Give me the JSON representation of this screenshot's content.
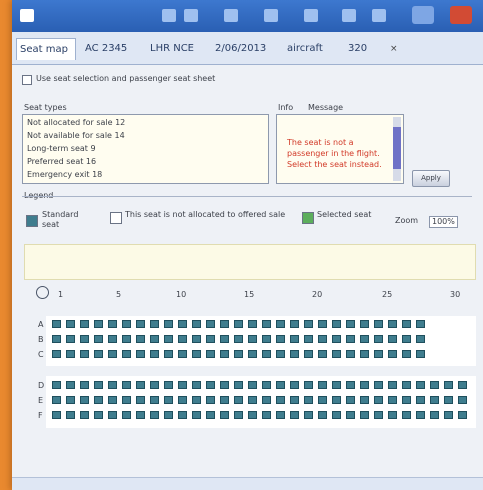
{
  "colors": {
    "accent": "#2a5fb3",
    "cell": "#3f7d8e",
    "message": "#d23a28"
  },
  "tabs": [
    {
      "label": "Seat map",
      "active": true
    },
    {
      "label": "AC 2345"
    },
    {
      "label": "LHR NCE"
    },
    {
      "label": "2/06/2013"
    },
    {
      "label": "aircraft"
    },
    {
      "label": "320"
    }
  ],
  "tab_close_icon": "×",
  "options": {
    "checkbox_label": "Use seat selection and passenger seat sheet"
  },
  "panels": {
    "list_label": "Seat types",
    "message_label": "Info",
    "message_header": "Message"
  },
  "seat_types": [
    "Not allocated for sale 12",
    "Not available for sale 14",
    "Long-term seat 9",
    "Preferred seat 16",
    "Emergency exit 18"
  ],
  "message_text": "The seat is not a passenger in the flight. Select the seat instead.",
  "apply_button": "Apply",
  "legend": {
    "title": "Legend",
    "items": [
      {
        "label": "Standard seat",
        "color": "#3f7d8e"
      },
      {
        "label": "This seat is not allocated to offered sale",
        "color": "#ffffff"
      },
      {
        "label": "Selected seat",
        "color": "#5cae5c"
      }
    ],
    "zoom_label": "Zoom",
    "zoom_value": "100%"
  },
  "map": {
    "columns": [
      "1",
      "5",
      "10",
      "15",
      "20",
      "25",
      "30"
    ],
    "upper_rows": [
      "A",
      "B",
      "C"
    ],
    "lower_rows": [
      "D",
      "E",
      "F"
    ],
    "upper_count": 27,
    "lower_count": 30
  }
}
